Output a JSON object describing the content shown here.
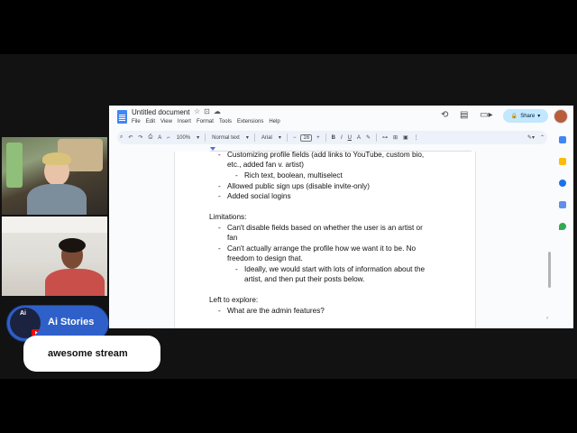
{
  "doc": {
    "title": "Untitled document",
    "menus": [
      "File",
      "Edit",
      "View",
      "Insert",
      "Format",
      "Tools",
      "Extensions",
      "Help"
    ],
    "share_label": "Share",
    "toolbar": {
      "zoom": "100%",
      "style": "Normal text",
      "font": "Arial",
      "size": "16"
    },
    "lines": [
      "Customizing profile fields (add links to YouTube, custom bio,",
      "etc., added fan v. artist)",
      "Rich text, boolean, multiselect",
      "Allowed public sign ups (disable invite-only)",
      "Added social logins",
      "Limitations:",
      "Can't disable fields based on whether the user is an artist or",
      "fan",
      "Can't actually arrange the profile how we want it to be. No",
      "freedom to design that.",
      "Ideally, we would start with lots of information about the",
      "artist, and then put their posts below.",
      "Left to explore:",
      "What are the admin features?"
    ]
  },
  "channel": {
    "name": "Ai Stories",
    "logo_text": "Ai"
  },
  "chat": {
    "message": "awesome stream"
  },
  "colors": {
    "accent": "#2f60c9",
    "share_bg": "#c2e7ff",
    "doc_blue": "#4285f4"
  }
}
